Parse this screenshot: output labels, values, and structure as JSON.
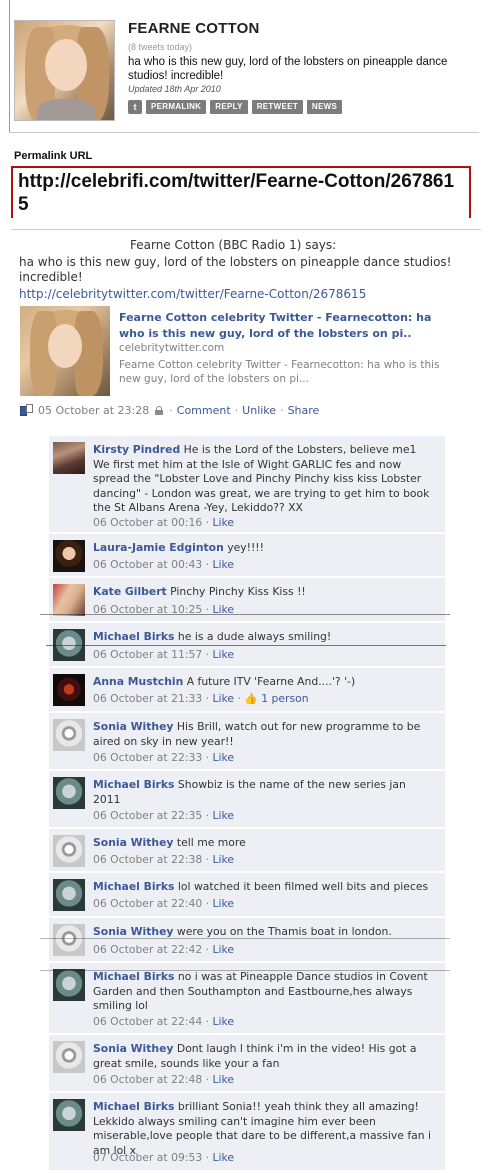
{
  "card": {
    "name": "FEARNE COTTON",
    "tweet_count": "(8 tweets today)",
    "tweet": "ha who is this new guy, lord of the lobsters on pineapple dance studios! incredible!",
    "updated": "Updated 18th Apr 2010",
    "buttons": [
      "PERMALINK",
      "REPLY",
      "RETWEET",
      "NEWS"
    ],
    "permalink_label": "Permalink URL",
    "permalink_url": "http://celebrifi.com/twitter/Fearne-Cotton/2678615"
  },
  "post": {
    "says": "Fearne Cotton (BBC Radio 1) says:",
    "text": "ha who is this new guy, lord of the lobsters on pineapple dance studios! incredible!",
    "link": "http://celebritytwitter.com/twitter/Fearne-Cotton/2678615",
    "share": {
      "title": "Fearne Cotton celebrity Twitter - Fearnecotton: ha who is this new guy, lord of the lobsters on pi..",
      "domain": "celebritytwitter.com",
      "desc": "Fearne Cotton celebrity Twitter - Fearnecotton: ha who is this new guy, lord of the lobsters on pi..."
    },
    "time": "05 October at 23:28",
    "actions": [
      "Comment",
      "Unlike",
      "Share"
    ]
  },
  "comments": [
    {
      "author": "Kirsty Pindred",
      "text": "He is the Lord of the Lobsters, believe me1 We first met him at the Isle of Wight GARLIC fes and now spread the \"Lobster Love and Pinchy Pinchy kiss kiss Lobster dancing\" - London was great, we are trying to get him to book the St Albans Arena -Yey, Lekiddo?? XX",
      "time": "06 October at 00:16",
      "like": "Like"
    },
    {
      "author": "Laura-Jamie Edginton",
      "text": "yey!!!!",
      "time": "06 October at 00:43",
      "like": "Like"
    },
    {
      "author": "Kate Gilbert",
      "text": "Pinchy Pinchy Kiss Kiss !!",
      "time": "06 October at 10:25",
      "like": "Like"
    },
    {
      "author": "Michael Birks",
      "text": "he is a dude always smiling!",
      "time": "06 October at 11:57",
      "like": "Like"
    },
    {
      "author": "Anna Mustchin",
      "text": "A future ITV 'Fearne And....'? '-)",
      "time": "06 October at 21:33",
      "like": "Like",
      "likes": "1 person"
    },
    {
      "author": "Sonia Withey",
      "text": "His Brill, watch out for new programme to be aired on sky in new year!!",
      "time": "06 October at 22:33",
      "like": "Like"
    },
    {
      "author": "Michael Birks",
      "text": "Showbiz is the name of the new series jan 2011",
      "time": "06 October at 22:35",
      "like": "Like"
    },
    {
      "author": "Sonia Withey",
      "text": "tell me more",
      "time": "06 October at 22:38",
      "like": "Like"
    },
    {
      "author": "Michael Birks",
      "text": "lol watched it been filmed well bits and pieces",
      "time": "06 October at 22:40",
      "like": "Like"
    },
    {
      "author": "Sonia Withey",
      "text": "were you on the Thamis boat in london.",
      "time": "06 October at 22:42",
      "like": "Like"
    },
    {
      "author": "Michael Birks",
      "text": "no i was at Pineapple Dance studios in Covent Garden and then Southampton and Eastbourne,hes always smiling lol",
      "time": "06 October at 22:44",
      "like": "Like"
    },
    {
      "author": "Sonia Withey",
      "text": "Dont laugh l think i'm in the video! His got a great smile, sounds like your a fan",
      "time": "06 October at 22:48",
      "like": "Like"
    },
    {
      "author": "Michael Birks",
      "text": "brilliant Sonia!! yeah think they all amazing! Lekkido always smiling can't imagine him ever been miserable,love people that dare to be different,a massive fan i am lol x",
      "time": "07 October at 09:53",
      "like": "Like"
    }
  ]
}
